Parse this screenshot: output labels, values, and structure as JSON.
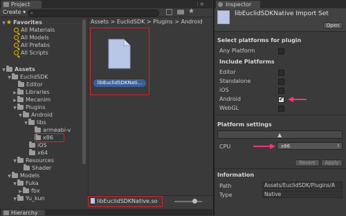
{
  "project": {
    "tab_label": "Project",
    "create_label": "Create ▾",
    "search_placeholder": "",
    "favorites": {
      "title": "Favorites",
      "items": [
        "All Materials",
        "All Models",
        "All Prefabs",
        "All Scripts"
      ]
    },
    "assets_root": "Assets",
    "tree": [
      "EuclidSDK",
      "Editor",
      "Libraries",
      "Mecanim",
      "Plugins",
      "Android",
      "libs",
      "armeabi-v",
      "x86",
      "iOS",
      "x64",
      "Resources",
      "Shader",
      "Models",
      "Fuka",
      "fbx",
      "Yu_kun"
    ],
    "breadcrumb": [
      "Assets",
      "EuclidSDK",
      "Plugins",
      "Android"
    ],
    "file": {
      "thumb_label": "libEuclidSDKNati...",
      "bottom_label": "libEuclidSDKNative.so"
    }
  },
  "hierarchy": {
    "tab_label": "Hierarchy"
  },
  "inspector": {
    "tab_label": "Inspector",
    "title": "libEuclidSDKNative Import Set",
    "open_label": "Open",
    "select_platforms_heading": "Select platforms for plugin",
    "any_platform": "Any Platform",
    "include_heading": "Include Platforms",
    "platforms": [
      {
        "name": "Editor",
        "checked": false
      },
      {
        "name": "Standalone",
        "checked": false
      },
      {
        "name": "iOS",
        "checked": false
      },
      {
        "name": "Android",
        "checked": true
      },
      {
        "name": "WebGL",
        "checked": false
      }
    ],
    "platform_settings_heading": "Platform settings",
    "cpu_label": "CPU",
    "cpu_value": "x86",
    "revert_label": "Revert",
    "apply_label": "Apply",
    "information_heading": "Information",
    "path_label": "Path",
    "path_value": "Assets/EuclidSDK/Plugins/A",
    "type_label": "Type",
    "type_value": "Native"
  },
  "colors": {
    "highlight_box": "#e0202a",
    "arrow": "#f0367c",
    "favorite_star": "#f3c000"
  }
}
